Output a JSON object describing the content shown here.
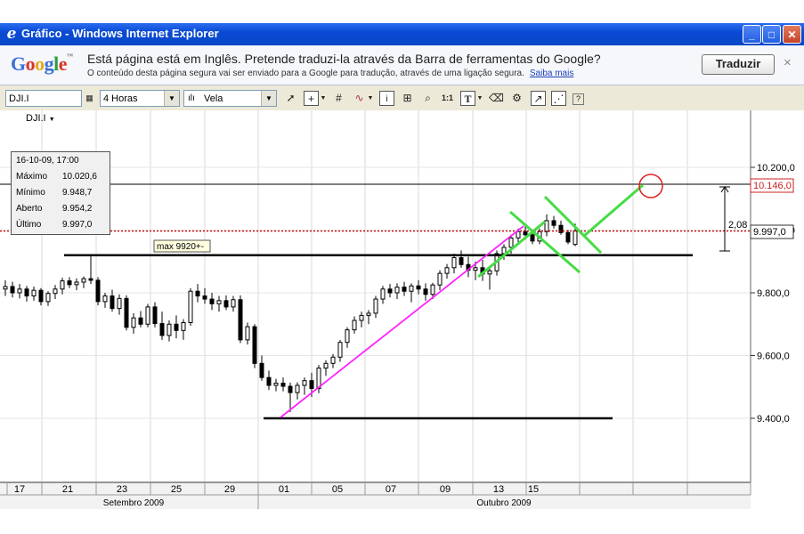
{
  "window": {
    "title": "Gráfico - Windows Internet Explorer"
  },
  "google_bar": {
    "message": "Está página está em Inglês.  Pretende traduzi-la através da Barra de ferramentas do Google?",
    "sub_message": "O conteúdo desta página segura vai ser enviado para a Google para tradução, através de uma ligação segura.",
    "learn_more": "Saiba mais",
    "translate_button": "Traduzir",
    "close_glyph": "×"
  },
  "toolbar": {
    "symbol": "DJI.I",
    "interval": "4 Horas",
    "chart_style": "Vela",
    "tool_ratio": "1:1",
    "tool_text": "T"
  },
  "chart": {
    "symbol_label": "DJI.I",
    "info_box": {
      "date": "16-10-09, 17:00",
      "rows": [
        {
          "label": "Máximo",
          "value": "10.020,6"
        },
        {
          "label": "Mínimo",
          "value": "9.948,7"
        },
        {
          "label": "Aberto",
          "value": "9.954,2"
        },
        {
          "label": "Último",
          "value": "9.997,0"
        }
      ]
    },
    "annotation": "max 9920+-",
    "price_tags": {
      "upper": "10.146,0",
      "last": "9.997,0"
    },
    "distance_label": "2,08"
  },
  "chart_data": {
    "type": "candlestick",
    "title": "DJI.I",
    "y_ticks": [
      "10.200,0",
      "10.000,0",
      "9.800,0",
      "9.600,0",
      "9.400,0"
    ],
    "y_tick_values": [
      10200,
      10000,
      9800,
      9600,
      9400
    ],
    "ylim": [
      9200,
      10300
    ],
    "x_ticks": [
      "17",
      "21",
      "23",
      "25",
      "29",
      "01",
      "05",
      "07",
      "09",
      "13",
      "15"
    ],
    "months": [
      "Setembro 2009",
      "Outubro 2009"
    ],
    "grid": true,
    "horizontal_lines": [
      9920,
      9400,
      10146
    ],
    "last_price": 9997,
    "candles": [
      [
        9812,
        9840,
        9790,
        9820
      ],
      [
        9820,
        9835,
        9785,
        9800
      ],
      [
        9800,
        9828,
        9782,
        9812
      ],
      [
        9812,
        9822,
        9772,
        9790
      ],
      [
        9790,
        9820,
        9775,
        9808
      ],
      [
        9808,
        9815,
        9760,
        9772
      ],
      [
        9772,
        9805,
        9758,
        9798
      ],
      [
        9798,
        9825,
        9780,
        9812
      ],
      [
        9812,
        9848,
        9795,
        9838
      ],
      [
        9838,
        9850,
        9815,
        9826
      ],
      [
        9826,
        9846,
        9808,
        9834
      ],
      [
        9834,
        9852,
        9815,
        9845
      ],
      [
        9845,
        9920,
        9828,
        9840
      ],
      [
        9840,
        9850,
        9760,
        9772
      ],
      [
        9772,
        9800,
        9752,
        9790
      ],
      [
        9790,
        9810,
        9740,
        9750
      ],
      [
        9750,
        9795,
        9730,
        9782
      ],
      [
        9782,
        9792,
        9680,
        9690
      ],
      [
        9690,
        9735,
        9670,
        9720
      ],
      [
        9720,
        9742,
        9690,
        9700
      ],
      [
        9700,
        9765,
        9690,
        9755
      ],
      [
        9755,
        9770,
        9690,
        9702
      ],
      [
        9702,
        9740,
        9650,
        9664
      ],
      [
        9664,
        9712,
        9645,
        9700
      ],
      [
        9700,
        9728,
        9655,
        9680
      ],
      [
        9680,
        9716,
        9650,
        9705
      ],
      [
        9705,
        9815,
        9695,
        9805
      ],
      [
        9805,
        9828,
        9770,
        9790
      ],
      [
        9790,
        9815,
        9765,
        9780
      ],
      [
        9780,
        9800,
        9745,
        9765
      ],
      [
        9765,
        9790,
        9740,
        9775
      ],
      [
        9775,
        9792,
        9745,
        9755
      ],
      [
        9755,
        9790,
        9740,
        9778
      ],
      [
        9778,
        9792,
        9640,
        9650
      ],
      [
        9650,
        9705,
        9635,
        9692
      ],
      [
        9692,
        9700,
        9560,
        9575
      ],
      [
        9575,
        9600,
        9520,
        9530
      ],
      [
        9530,
        9552,
        9490,
        9505
      ],
      [
        9505,
        9526,
        9486,
        9512
      ],
      [
        9512,
        9530,
        9486,
        9502
      ],
      [
        9502,
        9514,
        9420,
        9482
      ],
      [
        9482,
        9515,
        9460,
        9505
      ],
      [
        9505,
        9530,
        9475,
        9520
      ],
      [
        9520,
        9545,
        9468,
        9495
      ],
      [
        9495,
        9570,
        9480,
        9560
      ],
      [
        9560,
        9585,
        9535,
        9575
      ],
      [
        9575,
        9605,
        9560,
        9595
      ],
      [
        9595,
        9650,
        9580,
        9642
      ],
      [
        9642,
        9690,
        9625,
        9682
      ],
      [
        9682,
        9725,
        9670,
        9712
      ],
      [
        9712,
        9740,
        9690,
        9728
      ],
      [
        9728,
        9745,
        9700,
        9735
      ],
      [
        9735,
        9790,
        9720,
        9780
      ],
      [
        9780,
        9822,
        9765,
        9812
      ],
      [
        9812,
        9828,
        9785,
        9800
      ],
      [
        9800,
        9830,
        9780,
        9818
      ],
      [
        9818,
        9835,
        9790,
        9805
      ],
      [
        9805,
        9830,
        9770,
        9822
      ],
      [
        9822,
        9840,
        9795,
        9812
      ],
      [
        9812,
        9830,
        9775,
        9795
      ],
      [
        9795,
        9832,
        9780,
        9825
      ],
      [
        9825,
        9872,
        9808,
        9862
      ],
      [
        9862,
        9892,
        9845,
        9880
      ],
      [
        9880,
        9925,
        9862,
        9912
      ],
      [
        9912,
        9935,
        9880,
        9890
      ],
      [
        9890,
        9915,
        9850,
        9872
      ],
      [
        9872,
        9900,
        9840,
        9880
      ],
      [
        9880,
        9905,
        9838,
        9860
      ],
      [
        9860,
        9880,
        9810,
        9870
      ],
      [
        9870,
        9935,
        9855,
        9925
      ],
      [
        9925,
        9955,
        9905,
        9945
      ],
      [
        9945,
        9985,
        9925,
        9975
      ],
      [
        9975,
        10005,
        9955,
        9995
      ],
      [
        9995,
        10012,
        9970,
        9985
      ],
      [
        9985,
        10002,
        9955,
        9965
      ],
      [
        9965,
        10005,
        9955,
        9995
      ],
      [
        9995,
        10050,
        9980,
        10030
      ],
      [
        10030,
        10045,
        10005,
        10015
      ],
      [
        10015,
        10030,
        9985,
        9992
      ],
      [
        9992,
        10000,
        9955,
        9962
      ],
      [
        9954.2,
        10020.6,
        9948.7,
        9997.0
      ]
    ]
  }
}
